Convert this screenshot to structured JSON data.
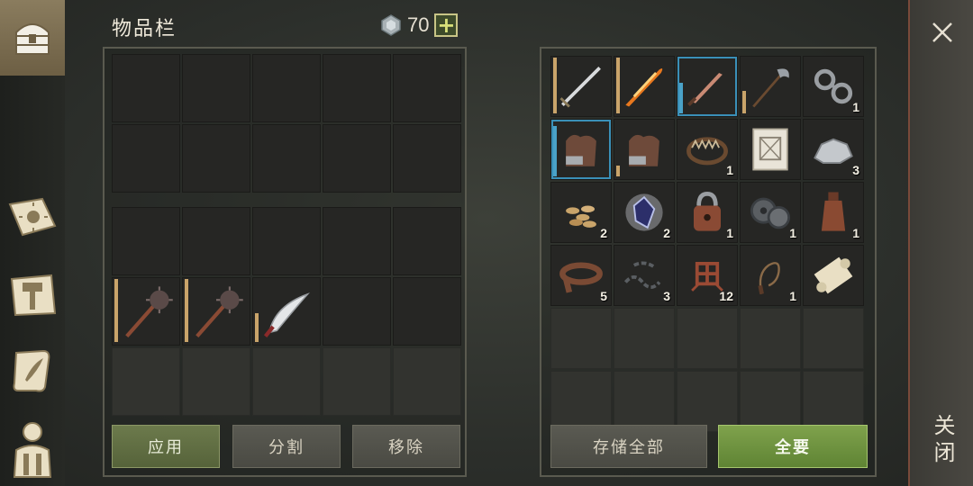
{
  "inventory": {
    "title": "物品栏",
    "currency_value": "70",
    "currency_add": "+"
  },
  "left_buttons": {
    "apply": "应用",
    "split": "分割",
    "remove": "移除"
  },
  "right_buttons": {
    "store_all": "存储全部",
    "take_all": "全要"
  },
  "close_panel": {
    "label": "关闭"
  },
  "left_slots": [
    {
      "item": "mace-icon",
      "durability": 1.0
    },
    {
      "item": "mace-icon",
      "durability": 1.0
    },
    {
      "item": "scimitar-icon",
      "durability": 0.45
    }
  ],
  "storage_items": [
    {
      "item": "sword-icon",
      "qty": "",
      "durability": 1.0,
      "border": "#c9a46a"
    },
    {
      "item": "flame-sword-icon",
      "qty": "",
      "durability": 1.0,
      "border": "#c9a46a"
    },
    {
      "item": "dagger-icon",
      "qty": "",
      "durability": 0.55,
      "border": "#4aa2c8"
    },
    {
      "item": "halberd-icon",
      "qty": "",
      "durability": 0.4,
      "border": "#c9a46a"
    },
    {
      "item": "shackles-icon",
      "qty": "1"
    },
    {
      "item": "gloves-icon",
      "qty": "",
      "durability": 0.9,
      "border": "#4aa2c8"
    },
    {
      "item": "gloves-icon",
      "qty": "",
      "durability": 0.2,
      "border": "#c9a46a"
    },
    {
      "item": "bear-trap-icon",
      "qty": "1"
    },
    {
      "item": "blueprint-icon",
      "qty": ""
    },
    {
      "item": "stone-icon",
      "qty": "3"
    },
    {
      "item": "seeds-icon",
      "qty": "2"
    },
    {
      "item": "crystal-icon",
      "qty": "2"
    },
    {
      "item": "padlock-icon",
      "qty": "1"
    },
    {
      "item": "gears-icon",
      "qty": "1"
    },
    {
      "item": "bottle-icon",
      "qty": "1"
    },
    {
      "item": "leather-strap-icon",
      "qty": "5"
    },
    {
      "item": "chain-icon",
      "qty": "3"
    },
    {
      "item": "rope-knot-icon",
      "qty": "12"
    },
    {
      "item": "whip-icon",
      "qty": "1"
    },
    {
      "item": "scroll-icon",
      "qty": ""
    }
  ],
  "colors": {
    "accent_green": "#7fa24c",
    "durability_gold": "#c9a46a",
    "durability_blue": "#4aa2c8",
    "close_border": "#7a4a3a"
  }
}
